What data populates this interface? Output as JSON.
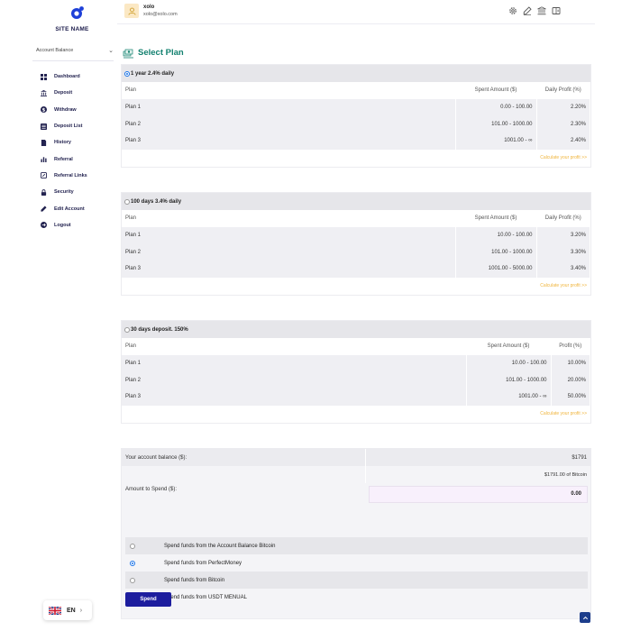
{
  "sidebar": {
    "site_name": "SITE NAME",
    "account_balance_label": "Account Balance",
    "items": [
      {
        "label": "Dashboard",
        "icon": "dashboard-icon"
      },
      {
        "label": "Deposit",
        "icon": "bank-icon"
      },
      {
        "label": "Withdraw",
        "icon": "dollar-circle-icon"
      },
      {
        "label": "Deposit List",
        "icon": "list-icon"
      },
      {
        "label": "History",
        "icon": "document-icon"
      },
      {
        "label": "Referral",
        "icon": "bar-chart-icon"
      },
      {
        "label": "Referral Links",
        "icon": "link-icon"
      },
      {
        "label": "Security",
        "icon": "lock-icon"
      },
      {
        "label": "Edit Account",
        "icon": "edit-icon"
      },
      {
        "label": "Logout",
        "icon": "logout-icon"
      }
    ],
    "language": "EN"
  },
  "topbar": {
    "username": "xolo",
    "email": "xolo@xolo.com"
  },
  "page": {
    "title": "Select Plan",
    "accent_color": "#12806f"
  },
  "plans": [
    {
      "name": "1 year 2.4% daily",
      "selected": true,
      "headers": [
        "Plan",
        "Spent Amount ($)",
        "Daily Profit (%)"
      ],
      "rows": [
        [
          "Plan 1",
          "0.00 - 100.00",
          "2.20%"
        ],
        [
          "Plan 2",
          "101.00 - 1000.00",
          "2.30%"
        ],
        [
          "Plan 3",
          "1001.00 - ∞",
          "2.40%"
        ]
      ],
      "calc_link": "Calculate your profit >>"
    },
    {
      "name": "100 days 3.4% daily",
      "selected": false,
      "headers": [
        "Plan",
        "Spent Amount ($)",
        "Daily Profit (%)"
      ],
      "rows": [
        [
          "Plan 1",
          "10.00 - 100.00",
          "3.20%"
        ],
        [
          "Plan 2",
          "101.00 - 1000.00",
          "3.30%"
        ],
        [
          "Plan 3",
          "1001.00 - 5000.00",
          "3.40%"
        ]
      ],
      "calc_link": "Calculate your profit >>"
    },
    {
      "name": "30 days deposit. 150%",
      "selected": false,
      "headers": [
        "Plan",
        "Spent Amount ($)",
        "Profit (%)"
      ],
      "rows": [
        [
          "Plan 1",
          "10.00 - 100.00",
          "10.00%"
        ],
        [
          "Plan 2",
          "101.00 - 1000.00",
          "20.00%"
        ],
        [
          "Plan 3",
          "1001.00 - ∞",
          "50.00%"
        ]
      ],
      "calc_link": "Calculate your profit >>"
    }
  ],
  "balance": {
    "label": "Your account balance ($):",
    "value": "$1791",
    "bitcoin": "$1791.00 of Bitcoin",
    "amount_label": "Amount to Spend ($):",
    "amount_value": "0.00",
    "options": [
      {
        "label": "Spend funds from the Account Balance Bitcoin",
        "selected": false
      },
      {
        "label": "Spend funds from PerfectMoney",
        "selected": true
      },
      {
        "label": "Spend funds from Bitcoin",
        "selected": false
      },
      {
        "label": "Spend funds from USDT MENUAL",
        "selected": false
      }
    ],
    "spend_button": "Spend"
  }
}
